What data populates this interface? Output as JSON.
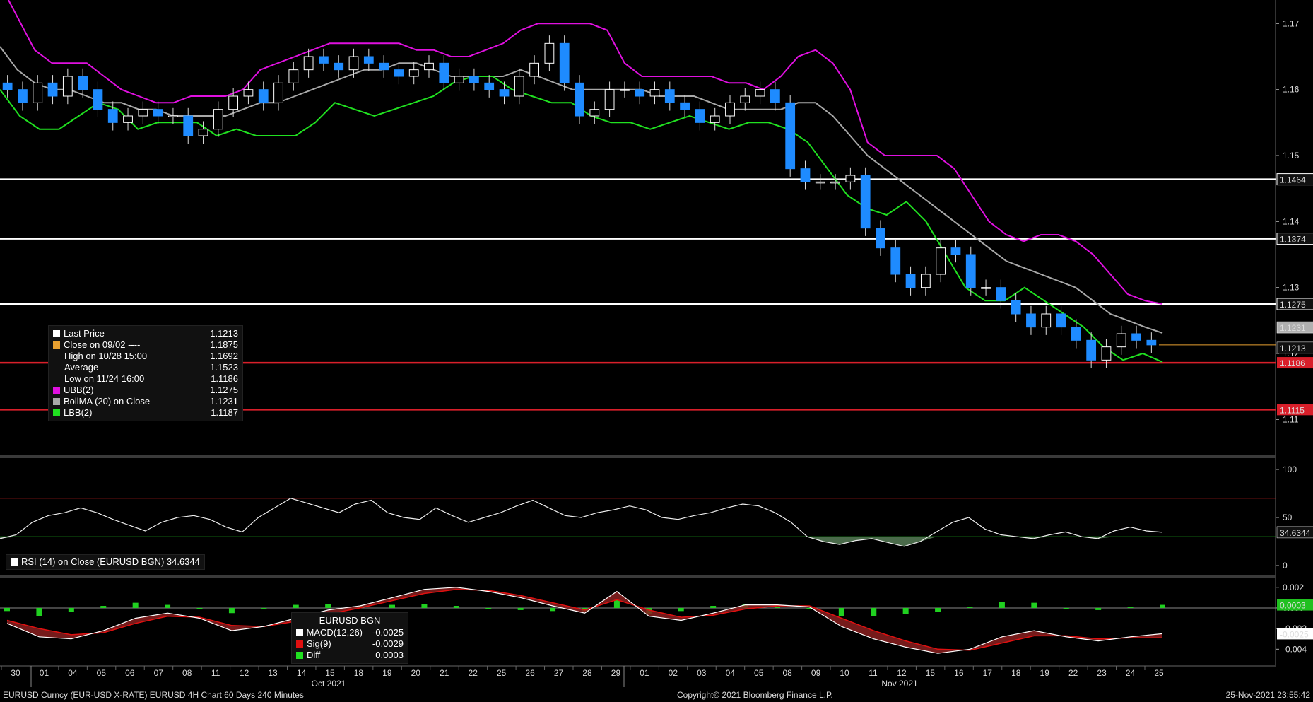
{
  "chart_data": {
    "type": "line",
    "instrument": "EURUSD Curncy (EUR-USD X-RATE) EURUSD 4H Chart 60 Days 240 Minutes",
    "price_panel": {
      "y_ticks": [
        "1.17",
        "1.16",
        "1.15",
        "1.14",
        "1.13",
        "1.12",
        "1.11"
      ],
      "ylim": [
        1.105,
        1.1725
      ],
      "horizontal_lines": [
        {
          "value": 1.1464,
          "label": "1.1464",
          "color": "#ffffff"
        },
        {
          "value": 1.1374,
          "label": "1.1374",
          "color": "#ffffff"
        },
        {
          "value": 1.1275,
          "label": "1.1275",
          "color": "#ffffff"
        },
        {
          "value": 1.1186,
          "label": "1.1186",
          "color": "#d81f2a"
        },
        {
          "value": 1.1115,
          "label": "1.1115",
          "color": "#d81f2a"
        }
      ],
      "last_price_line": {
        "value": 1.1213,
        "color": "#e8a030"
      },
      "side_labels": [
        {
          "value": 1.1231,
          "label": "1.1231",
          "bg": "#b0b0b0",
          "fg": "#000000"
        },
        {
          "value": 1.1213,
          "label": "1.1213",
          "bg": "#111111",
          "fg": "#ffffff"
        }
      ],
      "series": [
        {
          "name": "Close",
          "color": "#ffffff",
          "values": [
            1.16,
            1.158,
            1.161,
            1.159,
            1.162,
            1.16,
            1.157,
            1.155,
            1.156,
            1.157,
            1.156,
            1.156,
            1.153,
            1.154,
            1.157,
            1.159,
            1.16,
            1.158,
            1.161,
            1.163,
            1.165,
            1.164,
            1.163,
            1.165,
            1.164,
            1.163,
            1.162,
            1.163,
            1.164,
            1.161,
            1.162,
            1.161,
            1.16,
            1.159,
            1.162,
            1.164,
            1.167,
            1.161,
            1.156,
            1.157,
            1.16,
            1.16,
            1.159,
            1.16,
            1.158,
            1.157,
            1.155,
            1.156,
            1.158,
            1.159,
            1.16,
            1.158,
            1.148,
            1.146,
            1.146,
            1.146,
            1.147,
            1.139,
            1.136,
            1.132,
            1.13,
            1.132,
            1.136,
            1.135,
            1.13,
            1.13,
            1.128,
            1.126,
            1.124,
            1.126,
            1.124,
            1.122,
            1.119,
            1.121,
            1.123,
            1.122,
            1.1213
          ]
        },
        {
          "name": "UBB(2)",
          "color": "#e010e0",
          "values": [
            1.176,
            1.171,
            1.166,
            1.164,
            1.164,
            1.164,
            1.162,
            1.16,
            1.159,
            1.158,
            1.158,
            1.159,
            1.159,
            1.159,
            1.16,
            1.163,
            1.164,
            1.165,
            1.166,
            1.167,
            1.167,
            1.167,
            1.167,
            1.167,
            1.166,
            1.166,
            1.165,
            1.165,
            1.166,
            1.167,
            1.169,
            1.17,
            1.17,
            1.17,
            1.17,
            1.169,
            1.164,
            1.162,
            1.162,
            1.162,
            1.162,
            1.162,
            1.161,
            1.161,
            1.16,
            1.162,
            1.165,
            1.166,
            1.164,
            1.16,
            1.152,
            1.15,
            1.15,
            1.15,
            1.15,
            1.148,
            1.144,
            1.14,
            1.138,
            1.137,
            1.138,
            1.138,
            1.137,
            1.135,
            1.132,
            1.129,
            1.128,
            1.1275
          ]
        },
        {
          "name": "BollMA (20) on Close",
          "color": "#a8a8a8",
          "values": [
            1.1665,
            1.163,
            1.161,
            1.16,
            1.16,
            1.159,
            1.158,
            1.158,
            1.157,
            1.157,
            1.156,
            1.156,
            1.156,
            1.156,
            1.157,
            1.158,
            1.158,
            1.159,
            1.16,
            1.161,
            1.162,
            1.163,
            1.163,
            1.164,
            1.164,
            1.163,
            1.162,
            1.162,
            1.162,
            1.162,
            1.163,
            1.162,
            1.161,
            1.16,
            1.16,
            1.16,
            1.16,
            1.16,
            1.159,
            1.159,
            1.159,
            1.158,
            1.157,
            1.157,
            1.157,
            1.157,
            1.158,
            1.158,
            1.156,
            1.153,
            1.15,
            1.148,
            1.146,
            1.144,
            1.142,
            1.14,
            1.138,
            1.136,
            1.134,
            1.133,
            1.132,
            1.131,
            1.13,
            1.128,
            1.126,
            1.125,
            1.124,
            1.1231
          ]
        },
        {
          "name": "LBB(2)",
          "color": "#20e020",
          "values": [
            1.16,
            1.156,
            1.154,
            1.154,
            1.156,
            1.158,
            1.157,
            1.154,
            1.155,
            1.155,
            1.155,
            1.153,
            1.154,
            1.153,
            1.153,
            1.153,
            1.155,
            1.158,
            1.157,
            1.156,
            1.157,
            1.158,
            1.159,
            1.161,
            1.162,
            1.162,
            1.16,
            1.159,
            1.158,
            1.158,
            1.156,
            1.155,
            1.155,
            1.154,
            1.155,
            1.156,
            1.155,
            1.154,
            1.155,
            1.155,
            1.154,
            1.152,
            1.148,
            1.144,
            1.142,
            1.141,
            1.143,
            1.14,
            1.135,
            1.13,
            1.128,
            1.128,
            1.13,
            1.128,
            1.126,
            1.124,
            1.121,
            1.119,
            1.12,
            1.1187
          ]
        }
      ],
      "legend": {
        "rows": [
          {
            "label": "Last Price",
            "value": "1.1213",
            "color": "#ffffff",
            "mark": "box"
          },
          {
            "label": "Close on 09/02 ----",
            "value": "1.1875",
            "color": "#e8a030",
            "mark": "box"
          },
          {
            "label": "High on 10/28 15:00",
            "value": "1.1692",
            "color": "#bbbbbb",
            "mark": "text"
          },
          {
            "label": "Average",
            "value": "1.1523",
            "color": "#bbbbbb",
            "mark": "text"
          },
          {
            "label": "Low on 11/24 16:00",
            "value": "1.1186",
            "color": "#bbbbbb",
            "mark": "text"
          },
          {
            "label": "UBB(2)",
            "value": "1.1275",
            "color": "#e010e0",
            "mark": "box"
          },
          {
            "label": "BollMA (20)  on Close",
            "value": "1.1231",
            "color": "#a8a8a8",
            "mark": "box"
          },
          {
            "label": "LBB(2)",
            "value": "1.1187",
            "color": "#20e020",
            "mark": "box"
          }
        ]
      }
    },
    "rsi_panel": {
      "label": "RSI (14)  on Close (EURUSD BGN) 34.6344",
      "y_ticks": [
        "100",
        "50",
        "0"
      ],
      "ylim": [
        0,
        100
      ],
      "overbought": 70,
      "oversold": 30,
      "last_label": "34.6344",
      "values": [
        28,
        32,
        45,
        52,
        55,
        60,
        55,
        48,
        42,
        36,
        45,
        50,
        52,
        48,
        40,
        35,
        50,
        60,
        70,
        65,
        60,
        55,
        64,
        68,
        55,
        50,
        48,
        60,
        52,
        45,
        50,
        55,
        62,
        68,
        60,
        52,
        50,
        55,
        58,
        62,
        58,
        50,
        48,
        52,
        55,
        60,
        64,
        62,
        55,
        45,
        30,
        25,
        22,
        26,
        28,
        24,
        20,
        25,
        35,
        45,
        50,
        38,
        32,
        30,
        28,
        32,
        35,
        30,
        28,
        36,
        40,
        36,
        34.6344
      ]
    },
    "macd_panel": {
      "title": "EURUSD BGN",
      "y_ticks": [
        "0.002",
        "0.000",
        "-0.002",
        "-0.004"
      ],
      "ylim": [
        -0.0048,
        0.0026
      ],
      "side_labels": [
        {
          "value": 0.0003,
          "label": "0.0003",
          "bg": "#20c020",
          "fg": "#000000"
        },
        {
          "value": -0.0025,
          "label": "-0.0025",
          "bg": "#ffffff",
          "fg": "#000000"
        }
      ],
      "legend": {
        "rows": [
          {
            "label": "MACD(12,26)",
            "value": "-0.0025",
            "color": "#ffffff"
          },
          {
            "label": "Sig(9)",
            "value": "-0.0029",
            "color": "#e01010"
          },
          {
            "label": "Diff",
            "value": "0.0003",
            "color": "#20e020"
          }
        ]
      },
      "macd": [
        -0.0015,
        -0.0028,
        -0.003,
        -0.0022,
        -0.001,
        -0.0005,
        -0.001,
        -0.0022,
        -0.0018,
        -0.001,
        -0.0002,
        0.0002,
        0.001,
        0.0018,
        0.002,
        0.0016,
        0.001,
        0.0002,
        -0.0005,
        0.0016,
        -0.0008,
        -0.0012,
        -0.0005,
        0.0003,
        0.0003,
        0.0001,
        -0.0018,
        -0.003,
        -0.0038,
        -0.0044,
        -0.004,
        -0.0028,
        -0.0022,
        -0.0028,
        -0.0032,
        -0.0028,
        -0.0025
      ],
      "signal": [
        -0.0012,
        -0.002,
        -0.0026,
        -0.0024,
        -0.0015,
        -0.0008,
        -0.0009,
        -0.0017,
        -0.0018,
        -0.0013,
        -0.0006,
        0.0,
        0.0007,
        0.0014,
        0.0018,
        0.0017,
        0.0012,
        0.0005,
        -0.0002,
        0.0008,
        -0.0002,
        -0.0009,
        -0.0007,
        -0.0001,
        0.0002,
        0.0002,
        -0.001,
        -0.0022,
        -0.0032,
        -0.004,
        -0.0041,
        -0.0034,
        -0.0027,
        -0.0027,
        -0.003,
        -0.0029,
        -0.0029
      ],
      "diff": [
        -0.0003,
        -0.0008,
        -0.0004,
        0.0002,
        0.0005,
        0.0003,
        -0.0001,
        -0.0005,
        0.0,
        0.0003,
        0.0004,
        0.0002,
        0.0003,
        0.0004,
        0.0002,
        -0.0001,
        -0.0002,
        -0.0003,
        -0.0003,
        0.0008,
        -0.0006,
        -0.0003,
        0.0002,
        0.0004,
        0.0001,
        -0.0001,
        -0.0008,
        -0.0008,
        -0.0006,
        -0.0004,
        0.0001,
        0.0006,
        0.0005,
        -0.0001,
        -0.0002,
        0.0001,
        0.0003
      ]
    },
    "x_axis": {
      "tick_labels": [
        "30",
        "01",
        "04",
        "05",
        "06",
        "07",
        "08",
        "11",
        "12",
        "13",
        "14",
        "15",
        "18",
        "19",
        "20",
        "21",
        "22",
        "25",
        "26",
        "27",
        "28",
        "29",
        "01",
        "02",
        "03",
        "04",
        "05",
        "08",
        "09",
        "10",
        "11",
        "12",
        "15",
        "16",
        "17",
        "18",
        "19",
        "22",
        "23",
        "24",
        "25"
      ],
      "month_labels": [
        "Oct 2021",
        "Nov 2021"
      ]
    },
    "colors": {
      "up_candle": "#ffffff",
      "down_candle": "#1e8bff",
      "background": "#000000"
    }
  },
  "footer": {
    "left": "EURUSD Curncy (EUR-USD X-RATE) EURUSD 4H Chart 60 Days 240 Minutes",
    "center": "Copyright© 2021 Bloomberg Finance L.P.",
    "right": "25-Nov-2021 23:55:42"
  }
}
